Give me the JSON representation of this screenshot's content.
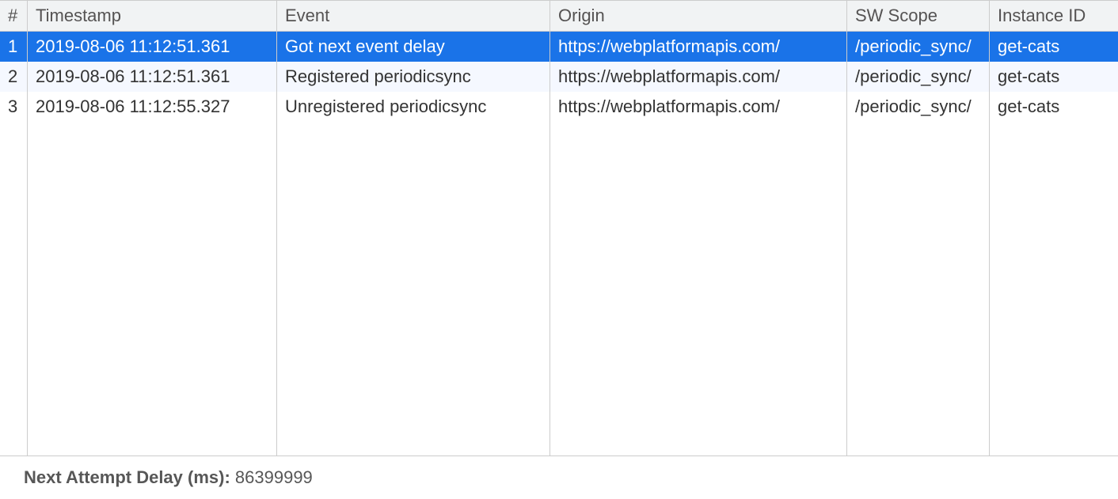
{
  "columns": {
    "num": "#",
    "timestamp": "Timestamp",
    "event": "Event",
    "origin": "Origin",
    "scope": "SW Scope",
    "instance": "Instance ID"
  },
  "rows": [
    {
      "num": "1",
      "timestamp": "2019-08-06 11:12:51.361",
      "event": "Got next event delay",
      "origin": "https://webplatformapis.com/",
      "scope": "/periodic_sync/",
      "instance": "get-cats",
      "selected": true
    },
    {
      "num": "2",
      "timestamp": "2019-08-06 11:12:51.361",
      "event": "Registered periodicsync",
      "origin": "https://webplatformapis.com/",
      "scope": "/periodic_sync/",
      "instance": "get-cats",
      "alt": true
    },
    {
      "num": "3",
      "timestamp": "2019-08-06 11:12:55.327",
      "event": "Unregistered periodicsync",
      "origin": "https://webplatformapis.com/",
      "scope": "/periodic_sync/",
      "instance": "get-cats"
    }
  ],
  "footer": {
    "label": "Next Attempt Delay (ms): ",
    "value": "86399999"
  }
}
